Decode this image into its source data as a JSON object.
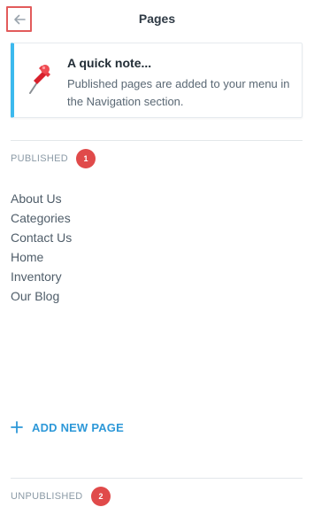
{
  "header": {
    "title": "Pages",
    "back_icon": "arrow-left-icon"
  },
  "note": {
    "title": "A quick note...",
    "body": "Published pages are added to your menu in the Navigation section.",
    "icon": "pushpin-icon",
    "accent_color": "#3cb9ee"
  },
  "published": {
    "label": "PUBLISHED",
    "count": "1",
    "pages": [
      {
        "label": "About Us"
      },
      {
        "label": "Categories"
      },
      {
        "label": "Contact Us"
      },
      {
        "label": "Home"
      },
      {
        "label": "Inventory"
      },
      {
        "label": "Our Blog"
      }
    ],
    "add_label": "ADD NEW PAGE"
  },
  "unpublished": {
    "label": "UNPUBLISHED",
    "count": "2"
  },
  "colors": {
    "badge": "#e04a4a",
    "link": "#2d98d8"
  }
}
